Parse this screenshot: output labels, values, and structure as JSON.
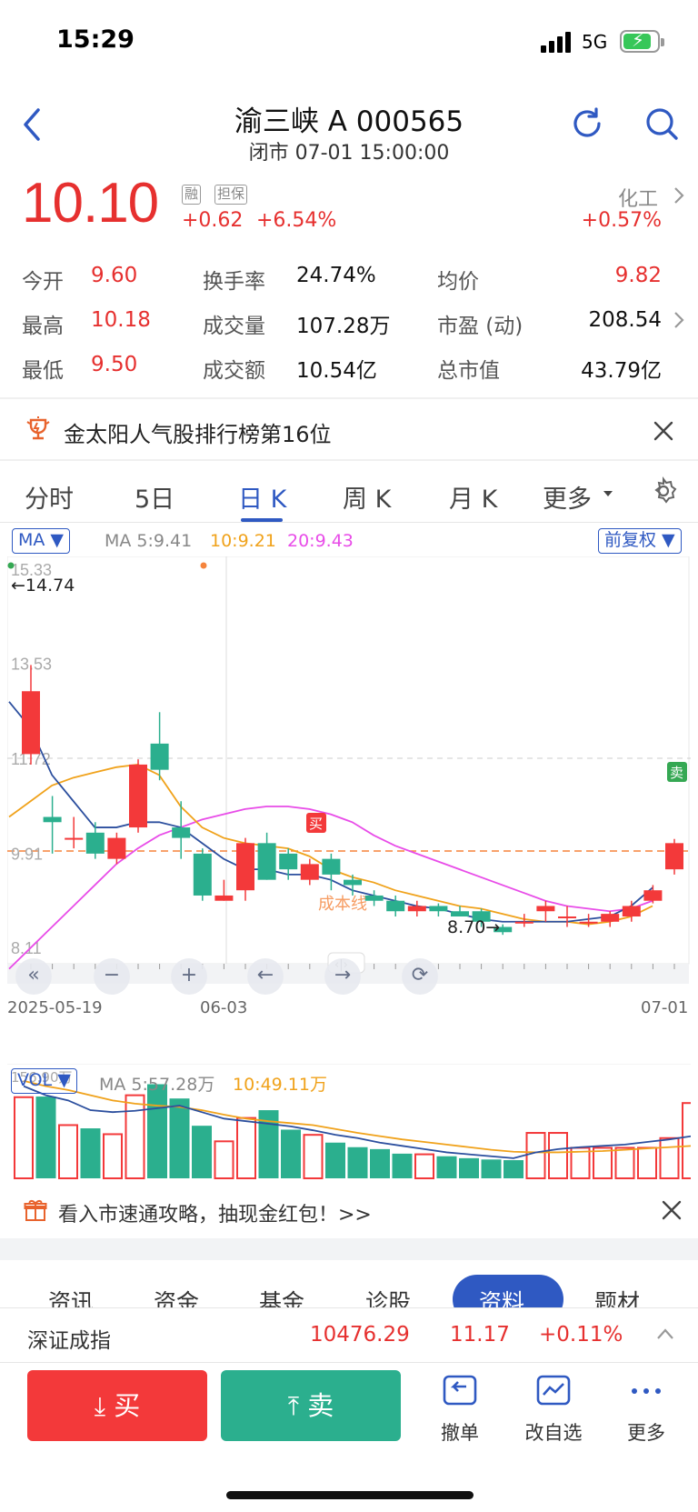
{
  "status": {
    "time": "15:29",
    "network": "5G"
  },
  "header": {
    "title": "渝三峡 A  000565",
    "subtitle": "闭市 07-01 15:00:00"
  },
  "quote": {
    "price": "10.10",
    "tags": [
      "融",
      "担保"
    ],
    "change_abs": "+0.62",
    "change_pct": "+6.54%",
    "sector": "化工",
    "sector_change": "+0.57%"
  },
  "stats": [
    {
      "label": "今开",
      "value": "9.60",
      "color": "red"
    },
    {
      "label": "换手率",
      "value": "24.74%",
      "color": ""
    },
    {
      "label": "均价",
      "value": "9.82",
      "color": "red"
    },
    {
      "label": "最高",
      "value": "10.18",
      "color": "red"
    },
    {
      "label": "成交量",
      "value": "107.28万",
      "color": ""
    },
    {
      "label": "市盈 (动)",
      "value": "208.54",
      "color": ""
    },
    {
      "label": "最低",
      "value": "9.50",
      "color": "red"
    },
    {
      "label": "成交额",
      "value": "10.54亿",
      "color": ""
    },
    {
      "label": "总市值",
      "value": "43.79亿",
      "color": ""
    }
  ],
  "banner": {
    "text": "金太阳人气股排行榜第16位"
  },
  "tabs": [
    "分时",
    "5日",
    "日 K",
    "周 K",
    "月 K",
    "更多"
  ],
  "active_tab": "日 K",
  "indicator": {
    "selector": "MA",
    "ma5": "MA 5:9.41",
    "ma10": "10:9.21",
    "ma20": "20:9.43",
    "adjust": "前复权"
  },
  "volume_indicator": {
    "selector": "VOL",
    "ma5": "MA 5:57.28万",
    "ma10": "10:49.11万",
    "max_label": "156.90万"
  },
  "colors": {
    "up": "#f3393a",
    "down": "#2baf8e",
    "ma5": "#2c4f9e",
    "ma10": "#f0a21b",
    "ma20": "#e84ce8",
    "accent": "#2f59c2"
  },
  "chart_data": {
    "type": "candlestick",
    "y_ticks": [
      "15.33",
      "13.53",
      "11.72",
      "9.91",
      "8.11"
    ],
    "ylim": [
      8.11,
      15.33
    ],
    "x_labels": [
      "2025-05-19",
      "06-03",
      "07-01"
    ],
    "annotations": {
      "high_marker": "←14.74",
      "low_marker": "8.70→",
      "buy_label": "买",
      "sell_label": "卖",
      "cost_line_label": "成本线",
      "cost_line_value": 9.95,
      "ref_line_value": 11.72
    },
    "candles": [
      {
        "o": 11.8,
        "c": 13.0,
        "h": 13.5,
        "l": 11.6
      },
      {
        "o": 10.6,
        "c": 10.5,
        "h": 11.0,
        "l": 9.9
      },
      {
        "o": 10.2,
        "c": 10.2,
        "h": 10.6,
        "l": 10.0
      },
      {
        "o": 10.3,
        "c": 9.9,
        "h": 10.5,
        "l": 9.8
      },
      {
        "o": 9.8,
        "c": 10.2,
        "h": 10.3,
        "l": 9.7
      },
      {
        "o": 10.4,
        "c": 11.6,
        "h": 11.7,
        "l": 10.3
      },
      {
        "o": 12.0,
        "c": 11.5,
        "h": 12.6,
        "l": 11.3
      },
      {
        "o": 10.4,
        "c": 10.2,
        "h": 10.9,
        "l": 9.8
      },
      {
        "o": 9.9,
        "c": 9.1,
        "h": 10.0,
        "l": 9.0
      },
      {
        "o": 9.0,
        "c": 9.1,
        "h": 9.4,
        "l": 9.0
      },
      {
        "o": 9.2,
        "c": 10.1,
        "h": 10.2,
        "l": 9.0
      },
      {
        "o": 10.1,
        "c": 9.4,
        "h": 10.3,
        "l": 9.4
      },
      {
        "o": 9.9,
        "c": 9.6,
        "h": 10.0,
        "l": 9.4
      },
      {
        "o": 9.4,
        "c": 9.7,
        "h": 9.8,
        "l": 9.3
      },
      {
        "o": 9.8,
        "c": 9.5,
        "h": 9.9,
        "l": 9.2
      },
      {
        "o": 9.4,
        "c": 9.3,
        "h": 9.5,
        "l": 9.1
      },
      {
        "o": 9.1,
        "c": 9.0,
        "h": 9.2,
        "l": 8.9
      },
      {
        "o": 9.0,
        "c": 8.8,
        "h": 9.1,
        "l": 8.7
      },
      {
        "o": 8.8,
        "c": 8.9,
        "h": 9.0,
        "l": 8.7
      },
      {
        "o": 8.9,
        "c": 8.8,
        "h": 8.95,
        "l": 8.7
      },
      {
        "o": 8.8,
        "c": 8.7,
        "h": 8.9,
        "l": 8.7
      },
      {
        "o": 8.8,
        "c": 8.6,
        "h": 8.85,
        "l": 8.5
      },
      {
        "o": 8.5,
        "c": 8.4,
        "h": 8.55,
        "l": 8.35
      },
      {
        "o": 8.6,
        "c": 8.6,
        "h": 8.75,
        "l": 8.5
      },
      {
        "o": 8.8,
        "c": 8.9,
        "h": 9.0,
        "l": 8.6
      },
      {
        "o": 8.7,
        "c": 8.7,
        "h": 8.9,
        "l": 8.5
      },
      {
        "o": 8.6,
        "c": 8.6,
        "h": 8.75,
        "l": 8.5
      },
      {
        "o": 8.6,
        "c": 8.75,
        "h": 8.8,
        "l": 8.5
      },
      {
        "o": 8.7,
        "c": 8.9,
        "h": 9.0,
        "l": 8.6
      },
      {
        "o": 9.0,
        "c": 9.2,
        "h": 9.3,
        "l": 8.95
      },
      {
        "o": 9.6,
        "c": 10.1,
        "h": 10.18,
        "l": 9.5
      }
    ],
    "ma5": [
      12.8,
      12.3,
      11.4,
      10.9,
      10.4,
      10.4,
      10.5,
      10.5,
      10.4,
      10.1,
      9.8,
      9.6,
      9.6,
      9.5,
      9.5,
      9.4,
      9.2,
      9.1,
      9.0,
      8.9,
      8.85,
      8.75,
      8.65,
      8.6,
      8.6,
      8.6,
      8.6,
      8.65,
      8.7,
      8.9,
      9.25
    ],
    "ma10": [
      10.6,
      10.9,
      11.2,
      11.35,
      11.45,
      11.55,
      11.6,
      11.4,
      10.8,
      10.4,
      10.2,
      10.1,
      10.05,
      10.0,
      9.85,
      9.6,
      9.45,
      9.35,
      9.2,
      9.1,
      9.0,
      8.9,
      8.85,
      8.75,
      8.65,
      8.6,
      8.6,
      8.55,
      8.6,
      8.7,
      8.9
    ],
    "ma20": [
      7.7,
      8.1,
      8.5,
      8.9,
      9.3,
      9.7,
      10.0,
      10.25,
      10.4,
      10.55,
      10.65,
      10.75,
      10.8,
      10.8,
      10.75,
      10.65,
      10.5,
      10.25,
      10.05,
      9.9,
      9.75,
      9.6,
      9.45,
      9.3,
      9.15,
      9.0,
      8.9,
      8.85,
      8.8,
      8.85,
      9.0
    ],
    "volumes": [
      125,
      126,
      82,
      77,
      68,
      128,
      145,
      123,
      81,
      57,
      93,
      105,
      75,
      67,
      55,
      48,
      45,
      38,
      37,
      34,
      31,
      29,
      28,
      70,
      70,
      47,
      47,
      47,
      47,
      62,
      116
    ],
    "vol_ma5": [
      142,
      128,
      120,
      105,
      102,
      104,
      108,
      112,
      102,
      92,
      88,
      84,
      80,
      74,
      67,
      62,
      55,
      50,
      45,
      40,
      37,
      34,
      31,
      40,
      45,
      48,
      50,
      52,
      56,
      60,
      65
    ],
    "vol_ma10": [
      150,
      142,
      136,
      128,
      120,
      115,
      112,
      110,
      105,
      98,
      92,
      88,
      85,
      82,
      76,
      70,
      65,
      60,
      56,
      52,
      48,
      44,
      41,
      40,
      40,
      41,
      42,
      44,
      46,
      48,
      50
    ]
  },
  "promo": {
    "text": "看入市速通攻略，抽现金红包！>>"
  },
  "sub_tabs": [
    "资讯",
    "资金",
    "基金",
    "诊股",
    "资料",
    "题材"
  ],
  "active_sub_tab": "资料",
  "index": {
    "name": "深证成指",
    "value": "10476.29",
    "change": "11.17",
    "pct": "+0.11%"
  },
  "actions": {
    "buy": "买",
    "sell": "卖",
    "cancel": "撤单",
    "edit_watch": "改自选",
    "more": "更多"
  }
}
